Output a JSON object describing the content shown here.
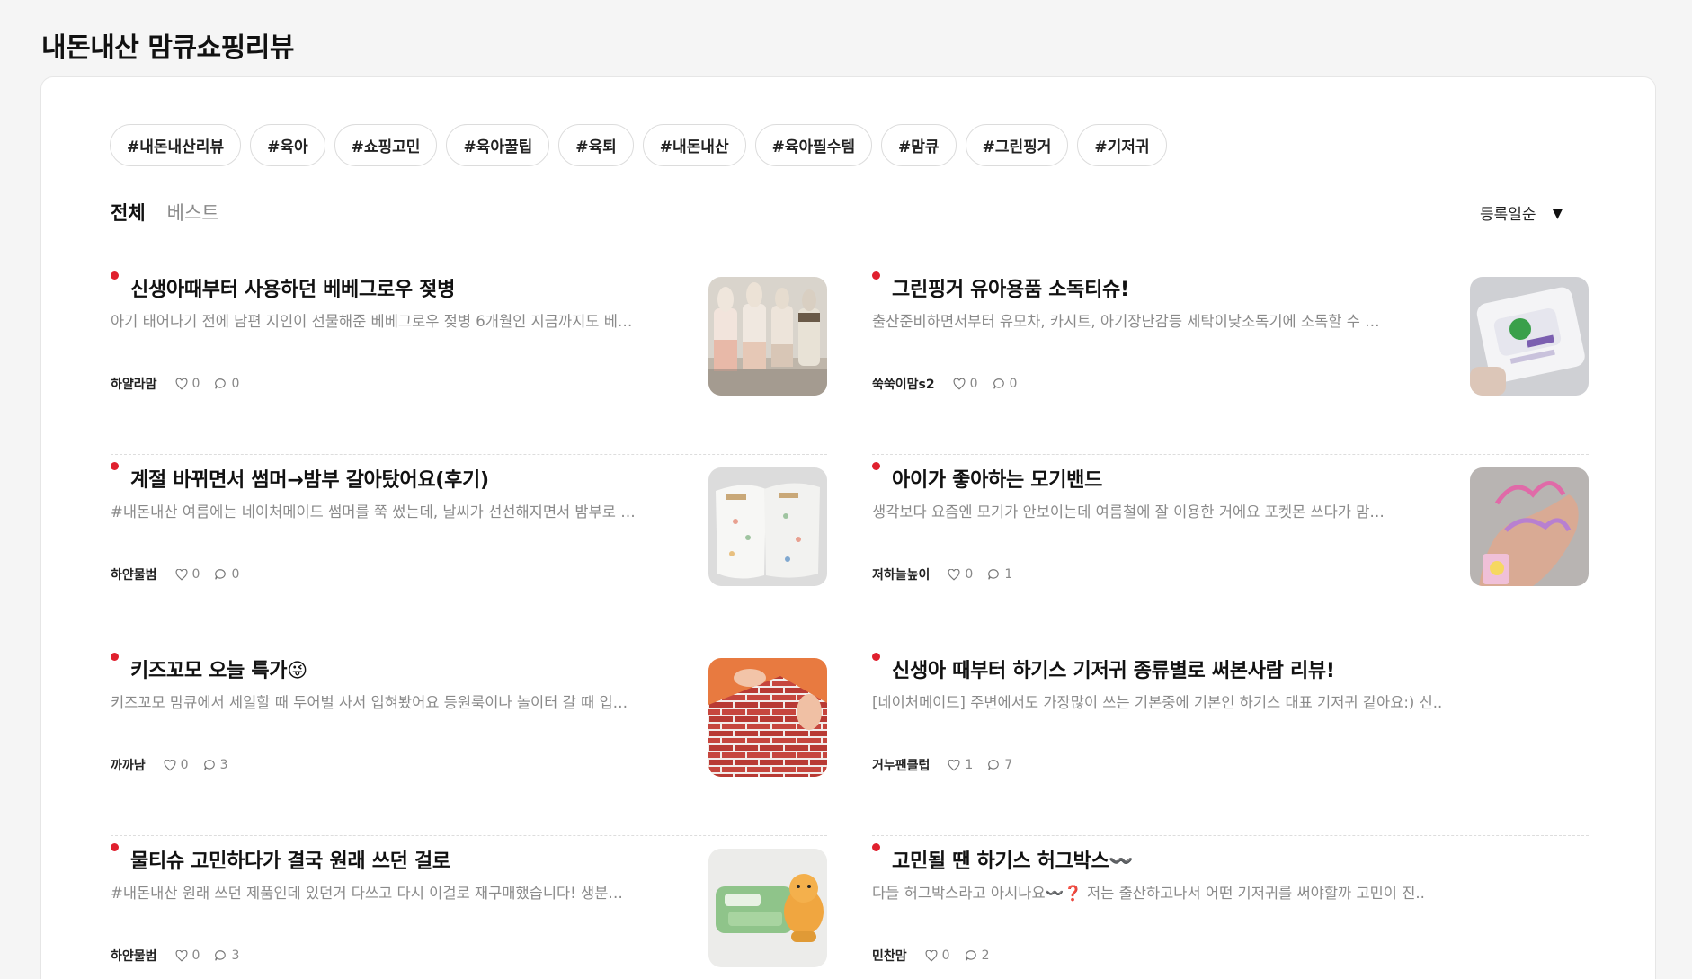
{
  "page": {
    "title": "내돈내산 맘큐쇼핑리뷰"
  },
  "tags": [
    "#내돈내산리뷰",
    "#육아",
    "#쇼핑고민",
    "#육아꿀팁",
    "#육퇴",
    "#내돈내산",
    "#육아필수템",
    "#맘큐",
    "#그린핑거",
    "#기저귀"
  ],
  "tabs": {
    "all": "전체",
    "best": "베스트"
  },
  "sort": {
    "label": "등록일순",
    "icon": "caret-down-icon"
  },
  "posts": [
    {
      "title": "신생아때부터 사용하던 베베그로우 젖병",
      "excerpt": "아기 태어나기 전에 남편 지인이 선물해준 베베그로우 젖병 6개월인 지금까지도 베…",
      "author": "하얄라맘",
      "likes": "0",
      "comments": "0",
      "thumb": "baby-bottles-photo"
    },
    {
      "title": "그린핑거 유아용품 소독티슈!",
      "excerpt": "출산준비하면서부터 유모차, 카시트, 아기장난감등 세탁이낮소독기에 소독할 수 …",
      "author": "쑥쑥이맘s2",
      "likes": "0",
      "comments": "0",
      "thumb": "wet-tissue-pack-photo"
    },
    {
      "title": "계절 바뀌면서 썸머→밤부 갈아탔어요(후기)",
      "excerpt": "#내돈내산 여름에는 네이처메이드 썸머를 쭉 썼는데, 날씨가 선선해지면서 밤부로 …",
      "author": "하얀물범",
      "likes": "0",
      "comments": "0",
      "thumb": "diapers-photo"
    },
    {
      "title": "아이가 좋아하는 모기밴드",
      "excerpt": "생각보다 요즘엔 모기가 안보이는데 여름철에 잘 이용한 거에요 포켓몬 쓰다가 맘…",
      "author": "저하늘높이",
      "likes": "0",
      "comments": "1",
      "thumb": "mosquito-band-photo"
    },
    {
      "title": "키즈꼬모 오늘 특가😜",
      "excerpt": "키즈꼬모 맘큐에서 세일할 때 두어벌 사서 입혀봤어요 등원룩이나 놀이터 갈 때 입…",
      "author": "까까냠",
      "likes": "0",
      "comments": "3",
      "thumb": "brick-blocks-photo"
    },
    {
      "title": "신생아 때부터 하기스 기저귀 종류별로 써본사람 리뷰!",
      "excerpt": "[네이처메이드] 주변에서도 가장많이 쓰는 기본중에 기본인 하기스 대표 기저귀 같아요:) 신..",
      "author": "거누팬클럽",
      "likes": "1",
      "comments": "7",
      "thumb": ""
    },
    {
      "title": "물티슈 고민하다가 결국 원래 쓰던 걸로",
      "excerpt": "#내돈내산 원래 쓰던 제품인데 있던거 다쓰고 다시 이걸로 재구매했습니다! 생분…",
      "author": "하얀물범",
      "likes": "0",
      "comments": "3",
      "thumb": "huggies-wipes-photo"
    },
    {
      "title": "고민될 땐 하기스 허그박스〰️",
      "excerpt": "다들 허그박스라고 아시나요〰️❓ 저는 출산하고나서 어떤 기저귀를 써야할까 고민이 진..",
      "author": "민찬맘",
      "likes": "0",
      "comments": "2",
      "thumb": ""
    }
  ],
  "icons": {
    "like": "heart-icon",
    "comment": "comment-icon",
    "new": "new-dot-icon"
  },
  "colors": {
    "accent": "#e0202e",
    "muted": "#8a8a8a",
    "border": "#dcdcdc"
  }
}
